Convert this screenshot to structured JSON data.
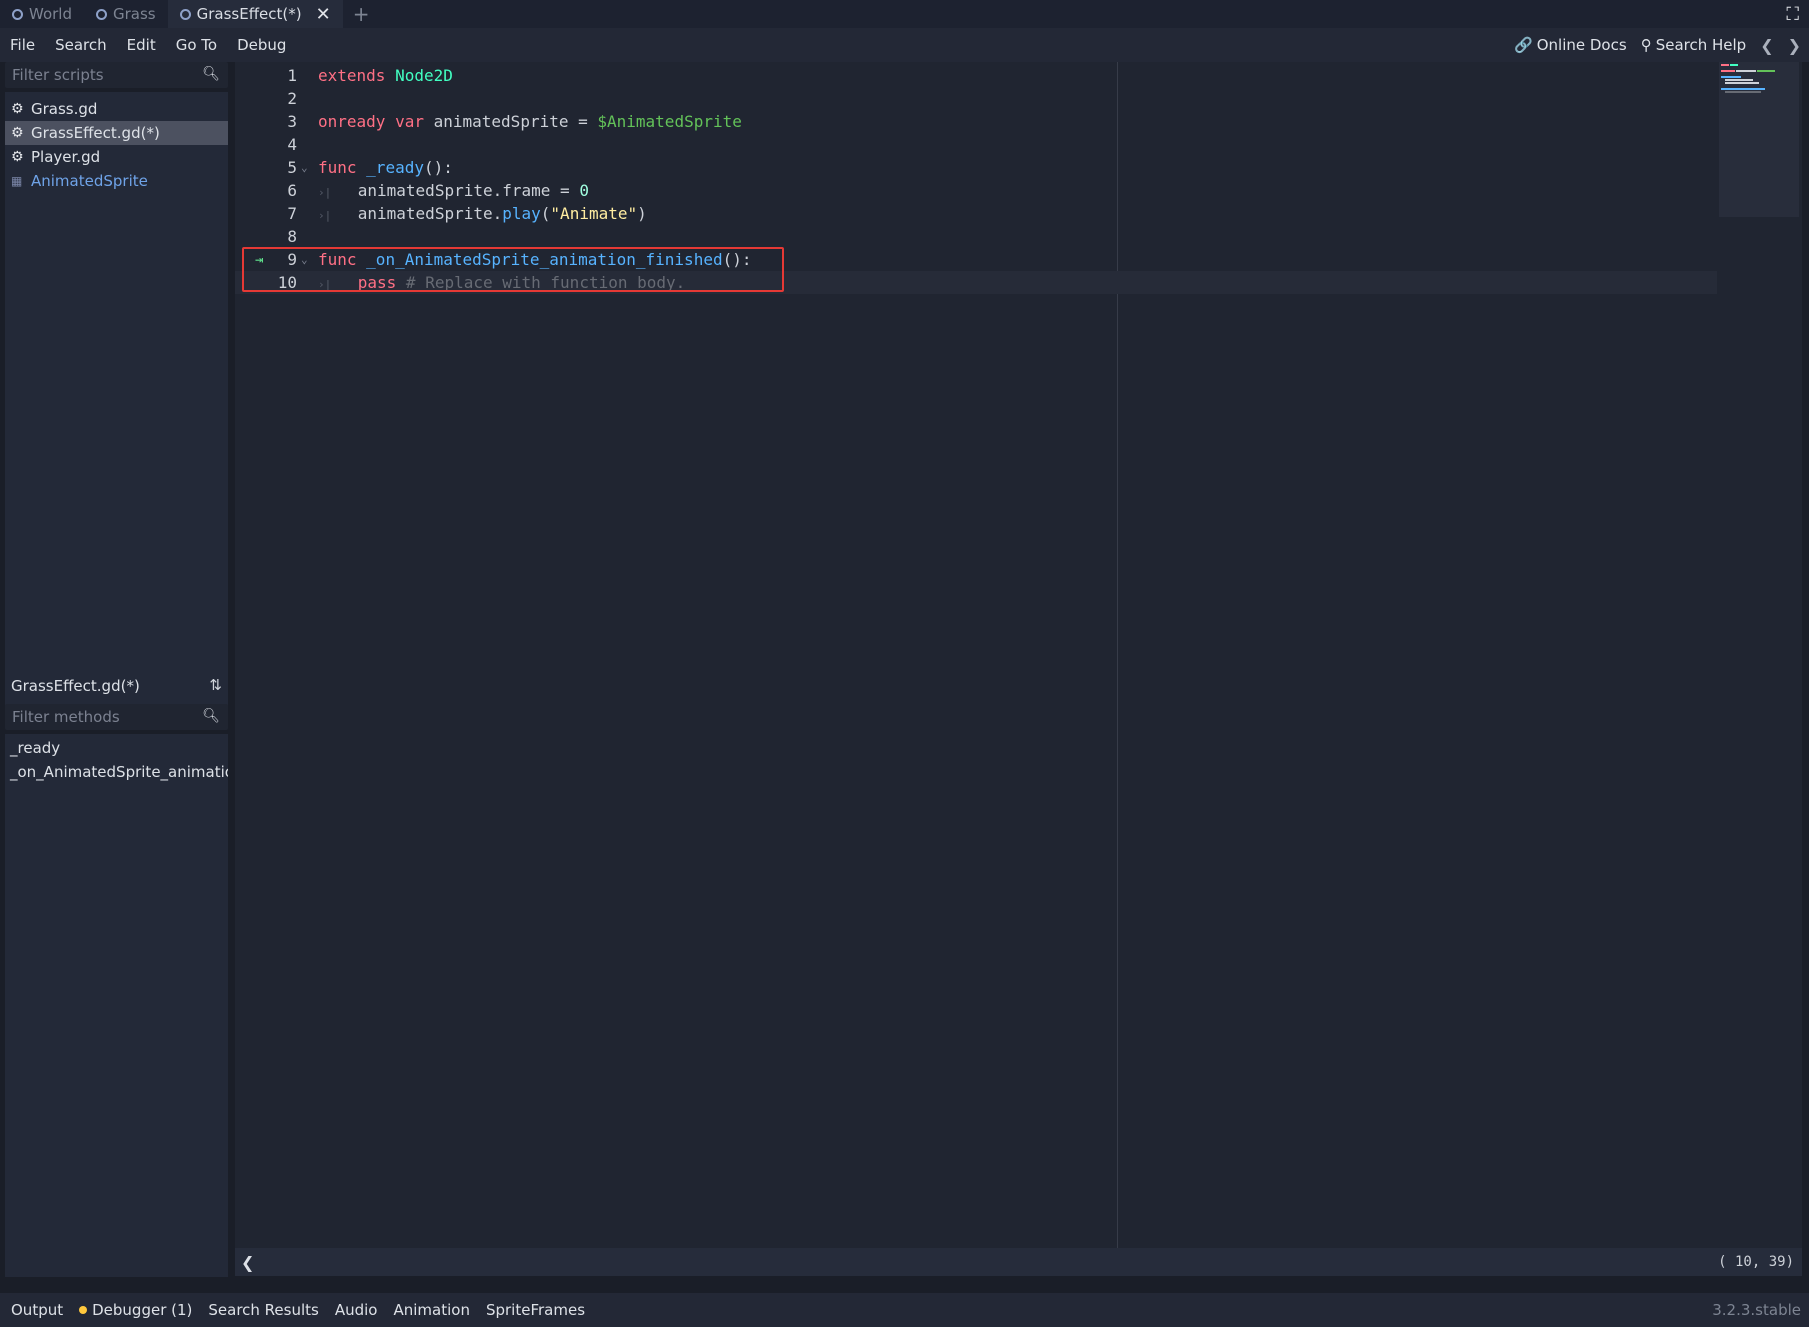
{
  "scene_tabs": [
    {
      "label": "World",
      "active": false
    },
    {
      "label": "Grass",
      "active": false
    },
    {
      "label": "GrassEffect(*)",
      "active": true
    }
  ],
  "add_tab": "+",
  "menu": [
    "File",
    "Search",
    "Edit",
    "Go To",
    "Debug"
  ],
  "toolbar": {
    "online_docs": "Online Docs",
    "search_help": "Search Help"
  },
  "scripts": {
    "filter_placeholder": "Filter scripts",
    "items": [
      {
        "label": "Grass.gd",
        "icon": "gear-icon"
      },
      {
        "label": "GrassEffect.gd(*)",
        "icon": "gear-icon"
      },
      {
        "label": "Player.gd",
        "icon": "gear-icon"
      },
      {
        "label": "AnimatedSprite",
        "icon": "animated-sprite-icon"
      }
    ]
  },
  "methods": {
    "title": "GrassEffect.gd(*)",
    "filter_placeholder": "Filter methods",
    "items": [
      "_ready",
      "_on_AnimatedSprite_animation_finished"
    ]
  },
  "code": [
    {
      "n": "1",
      "tokens": [
        [
          "kw",
          "extends"
        ],
        [
          "ident",
          " "
        ],
        [
          "cls",
          "Node2D"
        ]
      ]
    },
    {
      "n": "2",
      "tokens": []
    },
    {
      "n": "3",
      "tokens": [
        [
          "kw",
          "onready"
        ],
        [
          "ident",
          " "
        ],
        [
          "kw",
          "var"
        ],
        [
          "ident",
          " animatedSprite = "
        ],
        [
          "node",
          "$AnimatedSprite"
        ]
      ]
    },
    {
      "n": "4",
      "tokens": []
    },
    {
      "n": "5",
      "fold": true,
      "tokens": [
        [
          "kw",
          "func"
        ],
        [
          "ident",
          " "
        ],
        [
          "fn",
          "_ready"
        ],
        [
          "ident",
          "():"
        ]
      ]
    },
    {
      "n": "6",
      "indent": true,
      "tokens": [
        [
          "ident",
          "animatedSprite.frame = "
        ],
        [
          "num",
          "0"
        ]
      ]
    },
    {
      "n": "7",
      "indent": true,
      "tokens": [
        [
          "ident",
          "animatedSprite."
        ],
        [
          "fn",
          "play"
        ],
        [
          "ident",
          "("
        ],
        [
          "str",
          "\"Animate\""
        ],
        [
          "ident",
          ")"
        ]
      ]
    },
    {
      "n": "8",
      "tokens": []
    },
    {
      "n": "9",
      "fold": true,
      "signal": true,
      "tokens": [
        [
          "kw",
          "func"
        ],
        [
          "ident",
          " "
        ],
        [
          "fn",
          "_on_AnimatedSprite_animation_finished"
        ],
        [
          "ident",
          "():"
        ]
      ]
    },
    {
      "n": "10",
      "indent": true,
      "current": true,
      "tokens": [
        [
          "kw",
          "pass"
        ],
        [
          "ident",
          " "
        ],
        [
          "cm",
          "# Replace with function body."
        ]
      ]
    }
  ],
  "cursor": "( 10, 39)",
  "bottom_tabs": [
    "Output",
    "Debugger (1)",
    "Search Results",
    "Audio",
    "Animation",
    "SpriteFrames"
  ],
  "version": "3.2.3.stable"
}
